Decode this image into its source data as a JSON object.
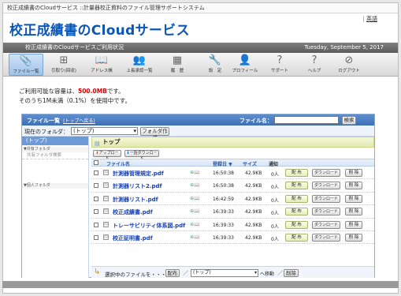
{
  "site": {
    "topline": "校正成績書のCloudサービス ::計量器校正資料のファイル管理サポートシステム",
    "brand": "校正成績書のCloudサービス",
    "lang_sep": "|",
    "lang_en": "英語",
    "subtitle": "校正成績書のCloudサービスご利用状況",
    "date": "Tuesday, September 5, 2017"
  },
  "nav": [
    {
      "label": "ファイル一覧",
      "icon": "paperclip-icon",
      "glyph": "📎"
    },
    {
      "label": "引取り(回収)",
      "icon": "inbox-icon",
      "glyph": "⊞"
    },
    {
      "label": "アドレス帳",
      "icon": "address-book-icon",
      "glyph": "📖"
    },
    {
      "label": "上長承認一覧",
      "icon": "users-icon",
      "glyph": "👥"
    },
    {
      "label": "履　歴",
      "icon": "history-icon",
      "glyph": "▦"
    },
    {
      "label": "設　定",
      "icon": "settings-icon",
      "glyph": "🔧"
    },
    {
      "label": "プロフィール",
      "icon": "profile-icon",
      "glyph": "👤"
    },
    {
      "label": "サポート",
      "icon": "support-icon",
      "glyph": "?"
    },
    {
      "label": "ヘルプ",
      "icon": "help-icon",
      "glyph": "?"
    },
    {
      "label": "ログアウト",
      "icon": "logout-icon",
      "glyph": "⊘"
    }
  ],
  "usage": {
    "line1_pre": "ご利用可能な容量は、",
    "line1_amount": "500.0MB",
    "line1_post": "です。",
    "line2": "そのうち1M未満（0.1%）を使用中です。"
  },
  "panel": {
    "title": "ファイル一覧",
    "to_top": "(トップへ戻る)",
    "filename_label": "ファイル名：",
    "filename_value": "",
    "search_button": "検索",
    "current_folder_label": "現在のフォルダ：",
    "current_folder_value": "(トップ)",
    "make_folder_button": "フォルダ作成"
  },
  "sidebar": {
    "top": "(トップ)",
    "shared_header": "▼共有フォルダ",
    "shared_search": "共有フォルダ検索",
    "personal_header": "▼個人フォルダ"
  },
  "files": {
    "crumb": "トップ",
    "upload_button": "アップロード",
    "bulk_download_button": "一括ダウンロード",
    "columns": {
      "name": "ファイル名",
      "date": "登録日 ▼",
      "size": "サイズ",
      "notice": "通知"
    },
    "rows": [
      {
        "name": "計測器管理規定.pdf",
        "time": "16:50:38",
        "size": "42.9KB",
        "notice": "0人"
      },
      {
        "name": "計測器リスト2.pdf",
        "time": "16:50:38",
        "size": "42.9KB",
        "notice": "0人"
      },
      {
        "name": "計測器リスト.pdf",
        "time": "16:42:59",
        "size": "42.9KB",
        "notice": "0人"
      },
      {
        "name": "校正成績書.pdf",
        "time": "16:39:33",
        "size": "42.9KB",
        "notice": "0人"
      },
      {
        "name": "トレーサビリティ体系図.pdf",
        "time": "16:39:33",
        "size": "42.9KB",
        "notice": "0人"
      },
      {
        "name": "校正証明書.pdf",
        "time": "16:39:33",
        "size": "42.9KB",
        "notice": "0人"
      }
    ],
    "dist_label": "配 布",
    "download_label": "ダウンロード",
    "delete_label": "削 除"
  },
  "bulk": {
    "text": "選択中のファイルを・・・",
    "distribute": "配布",
    "slash": "／",
    "target": "(トップ)",
    "move": "へ移動",
    "delete": "削除"
  }
}
